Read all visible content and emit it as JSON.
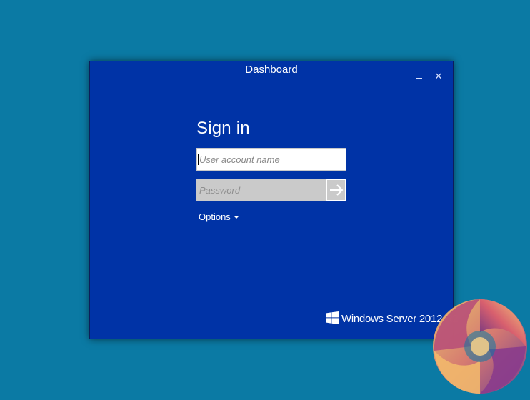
{
  "window": {
    "title": "Dashboard",
    "minimize_label": "–",
    "close_label": "✕"
  },
  "signin": {
    "heading": "Sign in",
    "username_placeholder": "User account name",
    "username_value": "",
    "password_placeholder": "Password",
    "password_value": "",
    "submit_icon": "arrow-right-icon",
    "options_label": "Options"
  },
  "branding": {
    "product_name": "Windows Server 2012 R2",
    "logo_icon": "windows-logo-icon"
  },
  "colors": {
    "desktop_background": "#0b7aa4",
    "window_background": "#0033a6",
    "password_field": "#cacaca"
  }
}
